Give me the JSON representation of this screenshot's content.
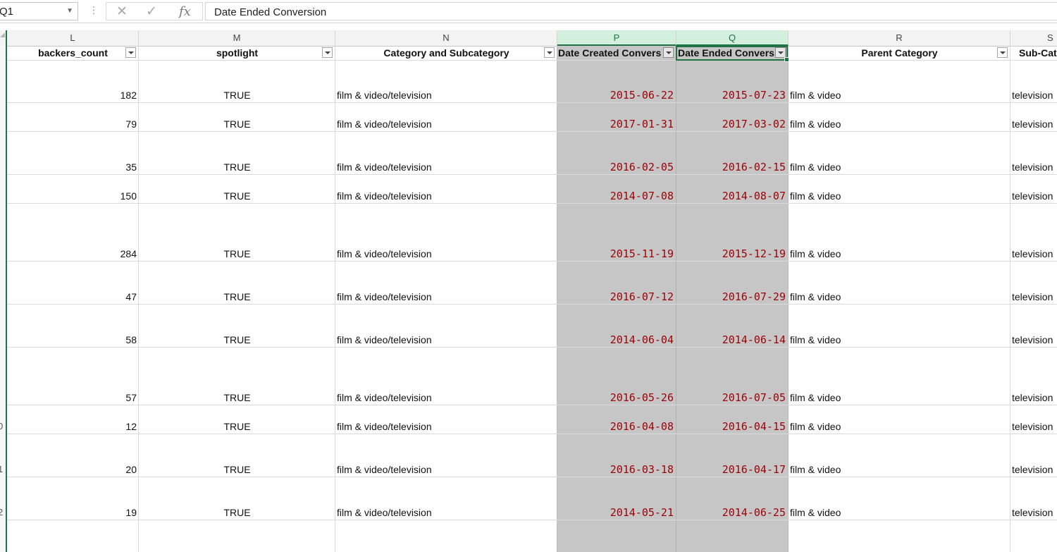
{
  "formula_bar": {
    "name_box": "Q1",
    "cancel_icon": "✕",
    "enter_icon": "✓",
    "function_icon": "fx",
    "formula": "Date Ended Conversion"
  },
  "columns": [
    "L",
    "M",
    "N",
    "P",
    "Q",
    "R",
    "S"
  ],
  "header_row": [
    "backers_count",
    "spotlight",
    "Category and Subcategory",
    "Date Created Convers",
    "Date Ended Convers",
    "Parent Category",
    "Sub-Cat"
  ],
  "row_numbers": [
    "0",
    "1",
    "2"
  ],
  "rows": [
    {
      "backers": "182",
      "spotlight": "TRUE",
      "category": "film & video/television",
      "created": "2015-06-22",
      "ended": "2015-07-23",
      "parent": "film & video",
      "sub": "television"
    },
    {
      "backers": "79",
      "spotlight": "TRUE",
      "category": "film & video/television",
      "created": "2017-01-31",
      "ended": "2017-03-02",
      "parent": "film & video",
      "sub": "television"
    },
    {
      "backers": "35",
      "spotlight": "TRUE",
      "category": "film & video/television",
      "created": "2016-02-05",
      "ended": "2016-02-15",
      "parent": "film & video",
      "sub": "television"
    },
    {
      "backers": "150",
      "spotlight": "TRUE",
      "category": "film & video/television",
      "created": "2014-07-08",
      "ended": "2014-08-07",
      "parent": "film & video",
      "sub": "television"
    },
    {
      "backers": "284",
      "spotlight": "TRUE",
      "category": "film & video/television",
      "created": "2015-11-19",
      "ended": "2015-12-19",
      "parent": "film & video",
      "sub": "television"
    },
    {
      "backers": "47",
      "spotlight": "TRUE",
      "category": "film & video/television",
      "created": "2016-07-12",
      "ended": "2016-07-29",
      "parent": "film & video",
      "sub": "television"
    },
    {
      "backers": "58",
      "spotlight": "TRUE",
      "category": "film & video/television",
      "created": "2014-06-04",
      "ended": "2014-06-14",
      "parent": "film & video",
      "sub": "television"
    },
    {
      "backers": "57",
      "spotlight": "TRUE",
      "category": "film & video/television",
      "created": "2016-05-26",
      "ended": "2016-07-05",
      "parent": "film & video",
      "sub": "television"
    },
    {
      "backers": "12",
      "spotlight": "TRUE",
      "category": "film & video/television",
      "created": "2016-04-08",
      "ended": "2016-04-15",
      "parent": "film & video",
      "sub": "television"
    },
    {
      "backers": "20",
      "spotlight": "TRUE",
      "category": "film & video/television",
      "created": "2016-03-18",
      "ended": "2016-04-17",
      "parent": "film & video",
      "sub": "television"
    },
    {
      "backers": "19",
      "spotlight": "TRUE",
      "category": "film & video/television",
      "created": "2014-05-21",
      "ended": "2014-06-25",
      "parent": "film & video",
      "sub": "television"
    }
  ],
  "colors": {
    "accent": "#217346",
    "date_text": "#9c0006",
    "selected_column": "#c6c6c6"
  }
}
